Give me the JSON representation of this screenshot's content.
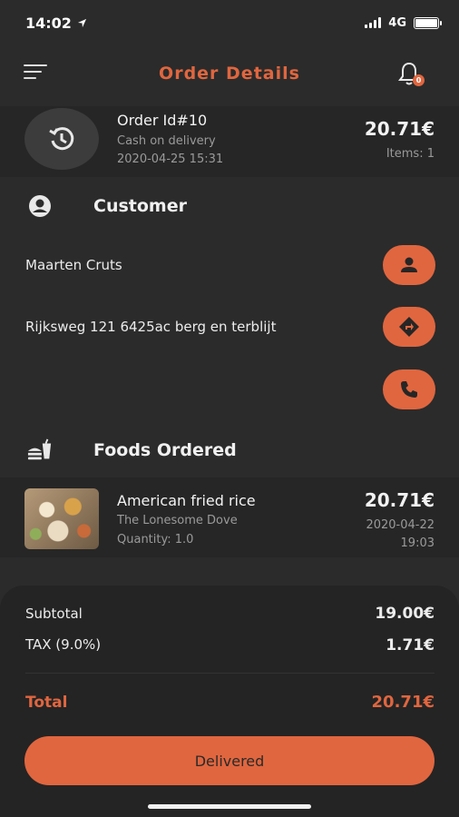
{
  "status_bar": {
    "time": "14:02",
    "network": "4G"
  },
  "header": {
    "title": "Order Details",
    "notification_count": "0"
  },
  "order": {
    "id_label": "Order Id#10",
    "payment_method": "Cash on delivery",
    "datetime": "2020-04-25 15:31",
    "total": "20.71€",
    "items": "Items: 1"
  },
  "customer": {
    "section_title": "Customer",
    "name": "Maarten Cruts",
    "address": "Rijksweg 121 6425ac berg en terblijt"
  },
  "foods": {
    "section_title": "Foods Ordered",
    "items": [
      {
        "name": "American fried rice",
        "restaurant": "The Lonesome Dove",
        "quantity": "Quantity: 1.0",
        "price": "20.71€",
        "date": "2020-04-22",
        "time": "19:03"
      }
    ]
  },
  "summary": {
    "subtotal_label": "Subtotal",
    "subtotal_value": "19.00€",
    "tax_label": "TAX (9.0%)",
    "tax_value": "1.71€",
    "total_label": "Total",
    "total_value": "20.71€",
    "status_button": "Delivered"
  },
  "colors": {
    "accent": "#e0663f",
    "background": "#2b2b2b",
    "card": "#262626"
  }
}
